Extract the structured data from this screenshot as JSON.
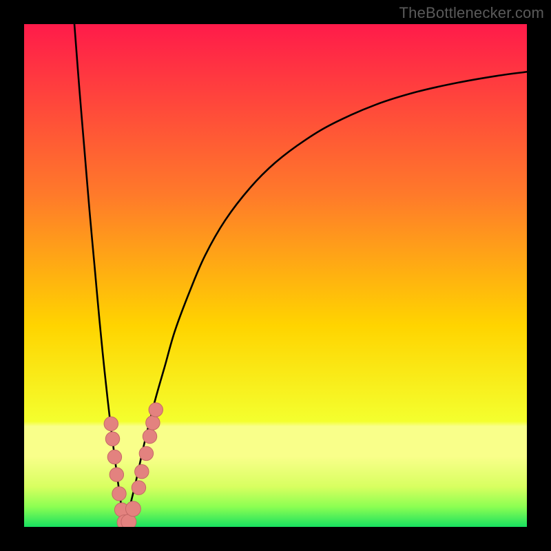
{
  "watermark_text": "TheBottlenecker.com",
  "colors": {
    "top": "#ff1b4a",
    "mid_upper": "#ff7a2a",
    "mid": "#ffd400",
    "mid_lower": "#f4ff2e",
    "band1": "#f9ff8a",
    "band2": "#d8ff60",
    "band3": "#8cff52",
    "bottom": "#18e060",
    "curve": "#000000",
    "marker_fill": "#e3827f",
    "marker_stroke": "#c46866",
    "frame": "#000000"
  },
  "chart_data": {
    "type": "line",
    "title": "",
    "xlabel": "",
    "ylabel": "",
    "xlim": [
      0,
      100
    ],
    "ylim": [
      0,
      100
    ],
    "x_optimum": 20,
    "series": [
      {
        "name": "left-branch",
        "x": [
          10,
          11,
          12,
          13,
          14,
          15,
          16,
          17,
          18,
          19,
          20
        ],
        "y": [
          100,
          87,
          75,
          63,
          52,
          41,
          31,
          22,
          14,
          6.5,
          0
        ]
      },
      {
        "name": "right-branch",
        "x": [
          20,
          22,
          24,
          26,
          28,
          30,
          33,
          36,
          40,
          45,
          50,
          56,
          62,
          70,
          78,
          86,
          94,
          100
        ],
        "y": [
          0,
          8,
          17,
          25,
          32,
          39,
          47,
          54,
          61,
          67.5,
          72.5,
          77,
          80.5,
          84,
          86.5,
          88.3,
          89.7,
          90.5
        ]
      }
    ],
    "markers": {
      "name": "bottleneck-samples",
      "points": [
        {
          "x": 17.3,
          "y": 20.5,
          "r": 1.4
        },
        {
          "x": 17.6,
          "y": 17.5,
          "r": 1.4
        },
        {
          "x": 18.0,
          "y": 13.9,
          "r": 1.4
        },
        {
          "x": 18.4,
          "y": 10.4,
          "r": 1.4
        },
        {
          "x": 18.9,
          "y": 6.6,
          "r": 1.4
        },
        {
          "x": 19.4,
          "y": 3.4,
          "r": 1.4
        },
        {
          "x": 20.0,
          "y": 0.9,
          "r": 1.5
        },
        {
          "x": 20.8,
          "y": 1.0,
          "r": 1.5
        },
        {
          "x": 21.7,
          "y": 3.6,
          "r": 1.5
        },
        {
          "x": 22.8,
          "y": 7.8,
          "r": 1.4
        },
        {
          "x": 23.4,
          "y": 11.0,
          "r": 1.4
        },
        {
          "x": 24.3,
          "y": 14.6,
          "r": 1.4
        },
        {
          "x": 25.0,
          "y": 18.0,
          "r": 1.4
        },
        {
          "x": 25.6,
          "y": 20.7,
          "r": 1.4
        },
        {
          "x": 26.2,
          "y": 23.3,
          "r": 1.4
        }
      ]
    }
  }
}
